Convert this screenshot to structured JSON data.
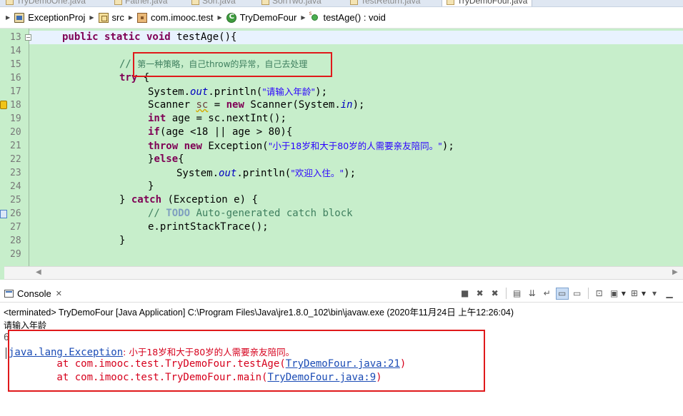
{
  "editor_tabs": [
    "TryDemoOne.java",
    "Father.java",
    "Son.java",
    "SonTwo.java",
    "TestReturn.java",
    "TryDemoFour.java"
  ],
  "breadcrumb": {
    "project": "ExceptionProj",
    "src": "src",
    "package": "com.imooc.test",
    "class": "TryDemoFour",
    "method": "testAge() : void"
  },
  "editor": {
    "line_numbers": [
      "13",
      "14",
      "15",
      "16",
      "17",
      "18",
      "19",
      "20",
      "21",
      "22",
      "23",
      "24",
      "25",
      "26",
      "27",
      "28",
      "29"
    ],
    "lines": {
      "l13_kw": "public static void",
      "l13_rest": " testAge(){",
      "l15_slashes": "// ",
      "l15_comment": "第一种策略，自己throw的异常，自己去处理",
      "l16_kw": "try",
      "l16_rest": " {",
      "l17_a": "System.",
      "l17_field": "out",
      "l17_b": ".println(",
      "l17_str": "\"请输入年龄\"",
      "l17_c": ");",
      "l18_a": "Scanner ",
      "l18_var": "sc",
      "l18_b": " = ",
      "l18_kw": "new",
      "l18_c": " Scanner(System.",
      "l18_field": "in",
      "l18_d": ");",
      "l19_kw": "int",
      "l19_rest": " age = sc.nextInt();",
      "l20_kw": "if",
      "l20_rest": "(age <18 || age > 80){",
      "l21_kw1": "throw",
      "l21_sp": " ",
      "l21_kw2": "new",
      "l21_a": " Exception(",
      "l21_str": "\"小于18岁和大于80岁的人需要亲友陪同。\"",
      "l21_b": ");",
      "l22_a": "}",
      "l22_kw": "else",
      "l22_b": "{",
      "l23_a": "System.",
      "l23_field": "out",
      "l23_b": ".println(",
      "l23_str": "\"欢迎入住。\"",
      "l23_c": ");",
      "l24": "}",
      "l25_a": "} ",
      "l25_kw": "catch",
      "l25_b": " (Exception e) {",
      "l26_a": "// ",
      "l26_todo": "TODO",
      "l26_b": " Auto-generated catch block",
      "l27": "e.printStackTrace();",
      "l28": "}"
    }
  },
  "console": {
    "tab_label": "Console",
    "status": "<terminated> TryDemoFour [Java Application] C:\\Program Files\\Java\\jre1.8.0_102\\bin\\javaw.exe (2020年11月24日 上午12:26:04)",
    "output_prompt": "请输入年龄",
    "input_value": "6",
    "error": {
      "exc_link": "java.lang.Exception",
      "exc_msg": ": 小于18岁和大于80岁的人需要亲友陪同。",
      "at1_prefix": "        at com.imooc.test.TryDemoFour.testAge(",
      "at1_link": "TryDemoFour.java:21",
      "at1_suffix": ")",
      "at2_prefix": "        at com.imooc.test.TryDemoFour.main(",
      "at2_link": "TryDemoFour.java:9",
      "at2_suffix": ")"
    }
  },
  "colors": {
    "editor_bg": "#c7eecb",
    "keyword": "#7f0055",
    "string": "#2a00ff",
    "comment": "#3f7f5f",
    "error_text": "#d6001c",
    "highlight_box": "#e0191b"
  }
}
